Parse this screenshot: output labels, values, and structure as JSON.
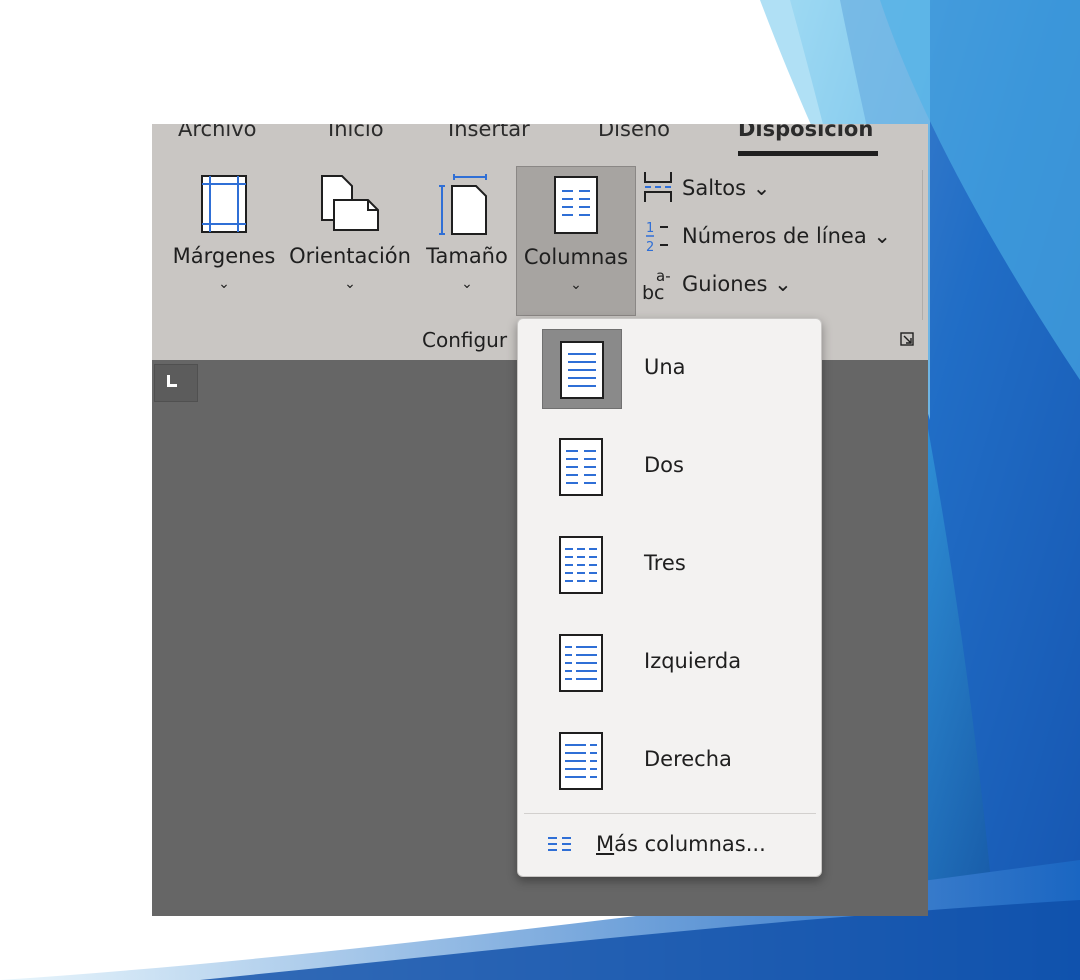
{
  "tabs": [
    {
      "label": "Archivo"
    },
    {
      "label": "Inicio"
    },
    {
      "label": "Insertar"
    },
    {
      "label": "Diseño"
    },
    {
      "label": "Disposición",
      "active": true
    }
  ],
  "ribbon": {
    "big_buttons": [
      {
        "label": "Márgenes",
        "icon": "margins-icon"
      },
      {
        "label": "Orientación",
        "icon": "orientation-icon"
      },
      {
        "label": "Tamaño",
        "icon": "size-icon"
      },
      {
        "label": "Columnas",
        "icon": "columns-icon",
        "pressed": true
      }
    ],
    "chevron": "⌄",
    "small_buttons": [
      {
        "label": "Saltos ⌄",
        "icon": "breaks-icon"
      },
      {
        "label": "Números de línea ⌄",
        "icon": "line-numbers-icon"
      },
      {
        "label": "Guiones ⌄",
        "icon": "hyphenation-icon"
      }
    ],
    "group_label": "Configur"
  },
  "columns_menu": {
    "items": [
      {
        "label": "Una",
        "icon": "one-column-icon",
        "selected": true
      },
      {
        "label": "Dos",
        "icon": "two-columns-icon"
      },
      {
        "label": "Tres",
        "icon": "three-columns-icon"
      },
      {
        "label": "Izquierda",
        "icon": "left-column-icon"
      },
      {
        "label": "Derecha",
        "icon": "right-column-icon"
      }
    ],
    "more_first_letter": "M",
    "more_rest": "ás columnas..."
  },
  "colors": {
    "ribbon_bg": "#c9c6c3",
    "document_bg": "#666666",
    "menu_bg": "#f3f2f1",
    "accent_blue": "#2f6fd6"
  }
}
